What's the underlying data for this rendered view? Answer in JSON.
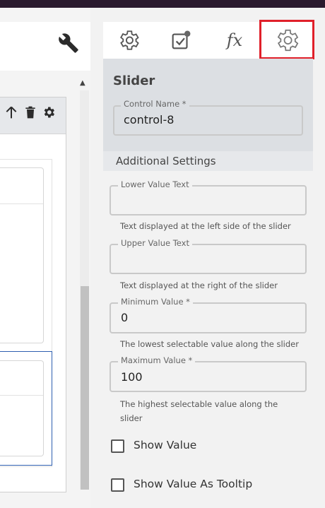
{
  "tabs": [
    {
      "icon": "gear-icon"
    },
    {
      "icon": "checkbox-notification-icon"
    },
    {
      "label": "fx"
    },
    {
      "icon": "gear-outline-icon"
    }
  ],
  "panel": {
    "title": "Slider",
    "control_name": {
      "label": "Control Name *",
      "value": "control-8"
    },
    "additional_settings": "Additional Settings"
  },
  "fields": {
    "lower": {
      "label": "Lower Value Text",
      "value": "",
      "hint": "Text displayed at the left side of the slider"
    },
    "upper": {
      "label": "Upper Value Text",
      "value": "",
      "hint": "Text displayed at the right of the slider"
    },
    "minimum": {
      "label": "Minimum Value *",
      "value": "0",
      "hint": "The lowest selectable value along the slider"
    },
    "maximum": {
      "label": "Maximum Value *",
      "value": "100",
      "hint": "The highest selectable value along the slider"
    }
  },
  "checkboxes": {
    "show_value": {
      "label": "Show Value",
      "checked": false
    },
    "show_tooltip": {
      "label": "Show Value As Tooltip",
      "checked": false
    }
  },
  "colors": {
    "active_tab_border": "#e0202a",
    "selection_border": "#2e5fb0"
  }
}
